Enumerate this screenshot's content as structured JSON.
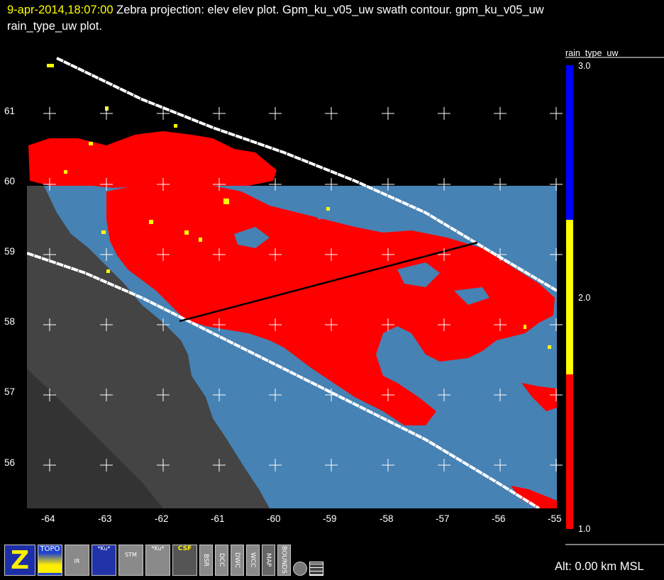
{
  "title": {
    "time": "9-apr-2014,18:07:00",
    "rest": "Zebra projection: elev elev  plot.  Gpm_ku_v05_uw swath contour.  gpm_ku_v05_uw",
    "line2": "rain_type_uw  plot."
  },
  "axes": {
    "lat_ticks": [
      "61",
      "60",
      "59",
      "58",
      "57",
      "56"
    ],
    "lon_ticks": [
      "-64",
      "-63",
      "-62",
      "-61",
      "-60",
      "-59",
      "-58",
      "-57",
      "-56",
      "-55"
    ]
  },
  "colorbar": {
    "title": "rain_type_uw",
    "labels": [
      "3.0",
      "2.0",
      "1.0"
    ],
    "colors": {
      "top": "#0000ff",
      "mid": "#ffff00",
      "bottom": "#ff0000"
    }
  },
  "colors": {
    "swath_fill": "#4682b4",
    "land": "#444444",
    "land_dark": "#333333",
    "rain_stratiform": "#ff0000",
    "rain_convective": "#ffff00",
    "swath_edge": "#ffffff",
    "cross_section": "#000000"
  },
  "toolbar": {
    "icons": [
      "zebra-logo-icon",
      "topo-icon",
      "ir-icon",
      "ku-icon",
      "stm-icon",
      "ku-vs-icon",
      "csf-gpm-icon",
      "bsr-icon",
      "dcc-icon",
      "dwc-icon",
      "wcc-icon",
      "map-icon",
      "bounds-icon",
      "circle-icon",
      "grid-icon"
    ],
    "labels": {
      "z": "Z",
      "topo": "TOPO",
      "ir": "IR",
      "ku": "*Ku*",
      "stm": "STM",
      "kuvs": "*Ku*",
      "csf": "CSF",
      "bsr": "BSR",
      "dcc": "DCC",
      "dwc": "DWC",
      "wcc": "WCC",
      "map": "MAP",
      "bounds": "BOUNDS"
    }
  },
  "status": {
    "altitude": "Alt: 0.00 km MSL"
  }
}
